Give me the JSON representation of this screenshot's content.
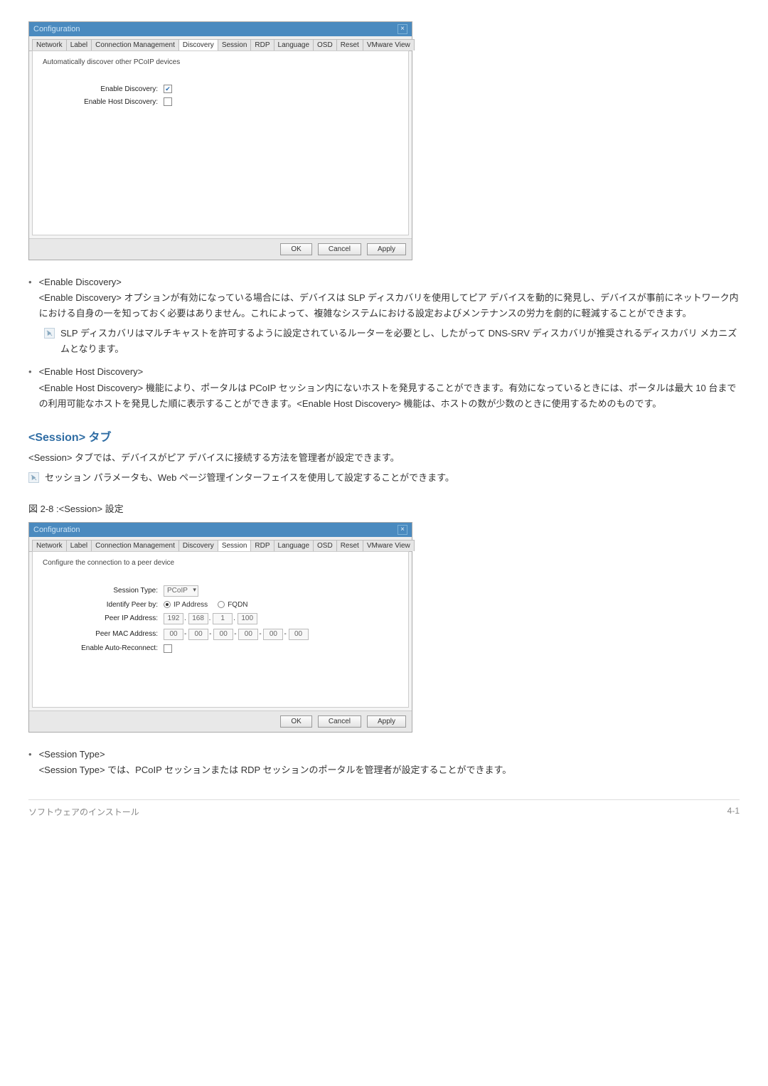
{
  "dialog1": {
    "title": "Configuration",
    "tabs": [
      "Network",
      "Label",
      "Connection Management",
      "Discovery",
      "Session",
      "RDP",
      "Language",
      "OSD",
      "Reset",
      "VMware View"
    ],
    "active_tab": "Discovery",
    "panel_desc": "Automatically discover other PCoIP devices",
    "rows": {
      "enable_discovery_label": "Enable Discovery:",
      "enable_discovery_checked": true,
      "enable_host_discovery_label": "Enable Host Discovery:",
      "enable_host_discovery_checked": false
    },
    "buttons": {
      "ok": "OK",
      "cancel": "Cancel",
      "apply": "Apply"
    }
  },
  "doc": {
    "b1_term": "<Enable Discovery>",
    "b1_text": "<Enable Discovery> オプションが有効になっている場合には、デバイスは SLP ディスカバリを使用してピア デバイスを動的に発見し、デバイスが事前にネットワーク内における自身の一を知っておく必要はありません。これによって、複雑なシステムにおける設定およびメンテナンスの労力を劇的に軽減することができます。",
    "note1": "SLP ディスカバリはマルチキャストを許可するように設定されているルーターを必要とし、したがって DNS-SRV ディスカバリが推奨されるディスカバリ メカニズムとなります。",
    "b2_term": "<Enable Host Discovery>",
    "b2_text": "<Enable Host Discovery> 機能により、ポータルは PCoIP セッション内にないホストを発見することができます。有効になっているときには、ポータルは最大 10 台までの利用可能なホストを発見した順に表示することができます。<Enable Host Discovery> 機能は、ホストの数が少数のときに使用するためのものです。",
    "session_heading": "<Session> タブ",
    "session_para": "<Session> タブでは、デバイスがピア デバイスに接続する方法を管理者が設定できます。",
    "note2": "セッション パラメータも、Web ページ管理インターフェイスを使用して設定することができます。",
    "fig_caption": "図  2-8 :<Session> 設定"
  },
  "dialog2": {
    "title": "Configuration",
    "tabs": [
      "Network",
      "Label",
      "Connection Management",
      "Discovery",
      "Session",
      "RDP",
      "Language",
      "OSD",
      "Reset",
      "VMware View"
    ],
    "active_tab": "Session",
    "panel_desc": "Configure the connection to a peer device",
    "session_type_label": "Session Type:",
    "session_type_value": "PCoIP",
    "identify_label": "Identify Peer by:",
    "radio_ip": "IP Address",
    "radio_fqdn": "FQDN",
    "peer_ip_label": "Peer IP Address:",
    "peer_ip": [
      "192",
      "168",
      "1",
      "100"
    ],
    "peer_mac_label": "Peer MAC Address:",
    "peer_mac": [
      "00",
      "00",
      "00",
      "00",
      "00",
      "00"
    ],
    "auto_reconnect_label": "Enable Auto-Reconnect:",
    "auto_reconnect_checked": false,
    "buttons": {
      "ok": "OK",
      "cancel": "Cancel",
      "apply": "Apply"
    }
  },
  "footer_block": {
    "b_term": "<Session Type>",
    "b_text": "<Session Type> では、PCoIP セッションまたは RDP セッションのポータルを管理者が設定することができます。"
  },
  "page_footer": {
    "left": "ソフトウェアのインストール",
    "right": "4-1"
  }
}
